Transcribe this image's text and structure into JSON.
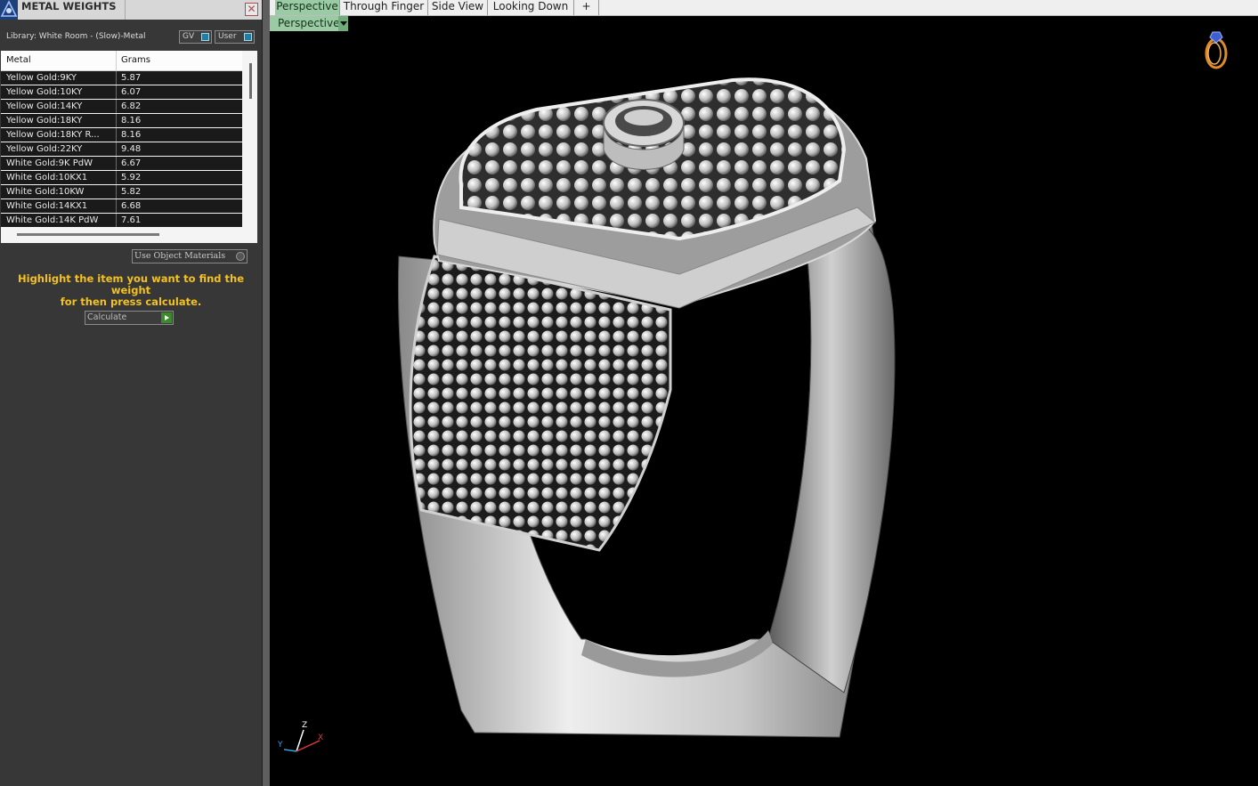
{
  "panel": {
    "title": "METAL WEIGHTS",
    "close_label": "✕",
    "library": "Library: White Room - (Slow)-Metal",
    "toggle_gv": "GV",
    "toggle_user": "User",
    "columns": [
      "Metal",
      "Grams"
    ],
    "rows": [
      {
        "metal": "Yellow Gold:9KY",
        "grams": "5.87"
      },
      {
        "metal": "Yellow Gold:10KY",
        "grams": "6.07"
      },
      {
        "metal": "Yellow Gold:14KY",
        "grams": "6.82"
      },
      {
        "metal": "Yellow Gold:18KY",
        "grams": "8.16"
      },
      {
        "metal": "Yellow Gold:18KY R...",
        "grams": "8.16"
      },
      {
        "metal": "Yellow Gold:22KY",
        "grams": "9.48"
      },
      {
        "metal": "White Gold:9K PdW",
        "grams": "6.67"
      },
      {
        "metal": "White Gold:10KX1",
        "grams": "5.92"
      },
      {
        "metal": "White Gold:10KW",
        "grams": "5.82"
      },
      {
        "metal": "White Gold:14KX1",
        "grams": "6.68"
      },
      {
        "metal": "White Gold:14K PdW",
        "grams": "7.61"
      }
    ],
    "use_object_materials": "Use Object Materials",
    "hint_line1": "Highlight the item you want to find the weight",
    "hint_line2": "for then press calculate.",
    "calculate_label": "Calculate"
  },
  "tabs": [
    {
      "label": "Perspective",
      "active": true
    },
    {
      "label": "Through Finger",
      "active": false
    },
    {
      "label": "Side View",
      "active": false
    },
    {
      "label": "Looking Down",
      "active": false
    }
  ],
  "add_tab_label": "+",
  "viewport": {
    "view_label": "Perspective",
    "axis_labels": {
      "x": "X",
      "y": "Y",
      "z": "Z"
    }
  },
  "colors": {
    "tab_active": "#9bcba4",
    "hint_text": "#f3c21e",
    "viewport_bg": "#000000",
    "metal": "#d9d9d9"
  }
}
